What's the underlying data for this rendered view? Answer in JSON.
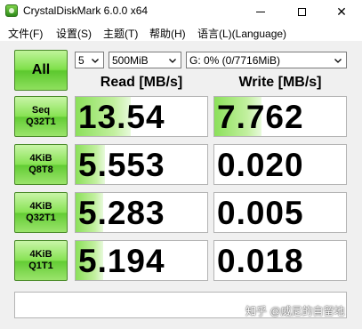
{
  "window": {
    "title": "CrystalDiskMark 6.0.0 x64"
  },
  "menu": [
    "文件(F)",
    "设置(S)",
    "主题(T)",
    "帮助(H)",
    "语言(L)(Language)"
  ],
  "controls": {
    "all_label": "All",
    "runs": "5",
    "size": "500MiB",
    "drive": "G: 0% (0/7716MiB)"
  },
  "headers": {
    "read": "Read [MB/s]",
    "write": "Write [MB/s]"
  },
  "tests": [
    {
      "line1": "Seq",
      "line2": "Q32T1",
      "read": "13.54",
      "write": "7.762",
      "read_bar": 0.42,
      "write_bar": 0.36
    },
    {
      "line1": "4KiB",
      "line2": "Q8T8",
      "read": "5.553",
      "write": "0.020",
      "read_bar": 0.22,
      "write_bar": 0.0
    },
    {
      "line1": "4KiB",
      "line2": "Q32T1",
      "read": "5.283",
      "write": "0.005",
      "read_bar": 0.21,
      "write_bar": 0.0
    },
    {
      "line1": "4KiB",
      "line2": "Q1T1",
      "read": "5.194",
      "write": "0.018",
      "read_bar": 0.21,
      "write_bar": 0.0
    }
  ],
  "comment": "",
  "watermark": "知乎 @威尼的自留地",
  "colors": {
    "accent_green": "#63cc34",
    "bar_green": "#8be05a"
  }
}
